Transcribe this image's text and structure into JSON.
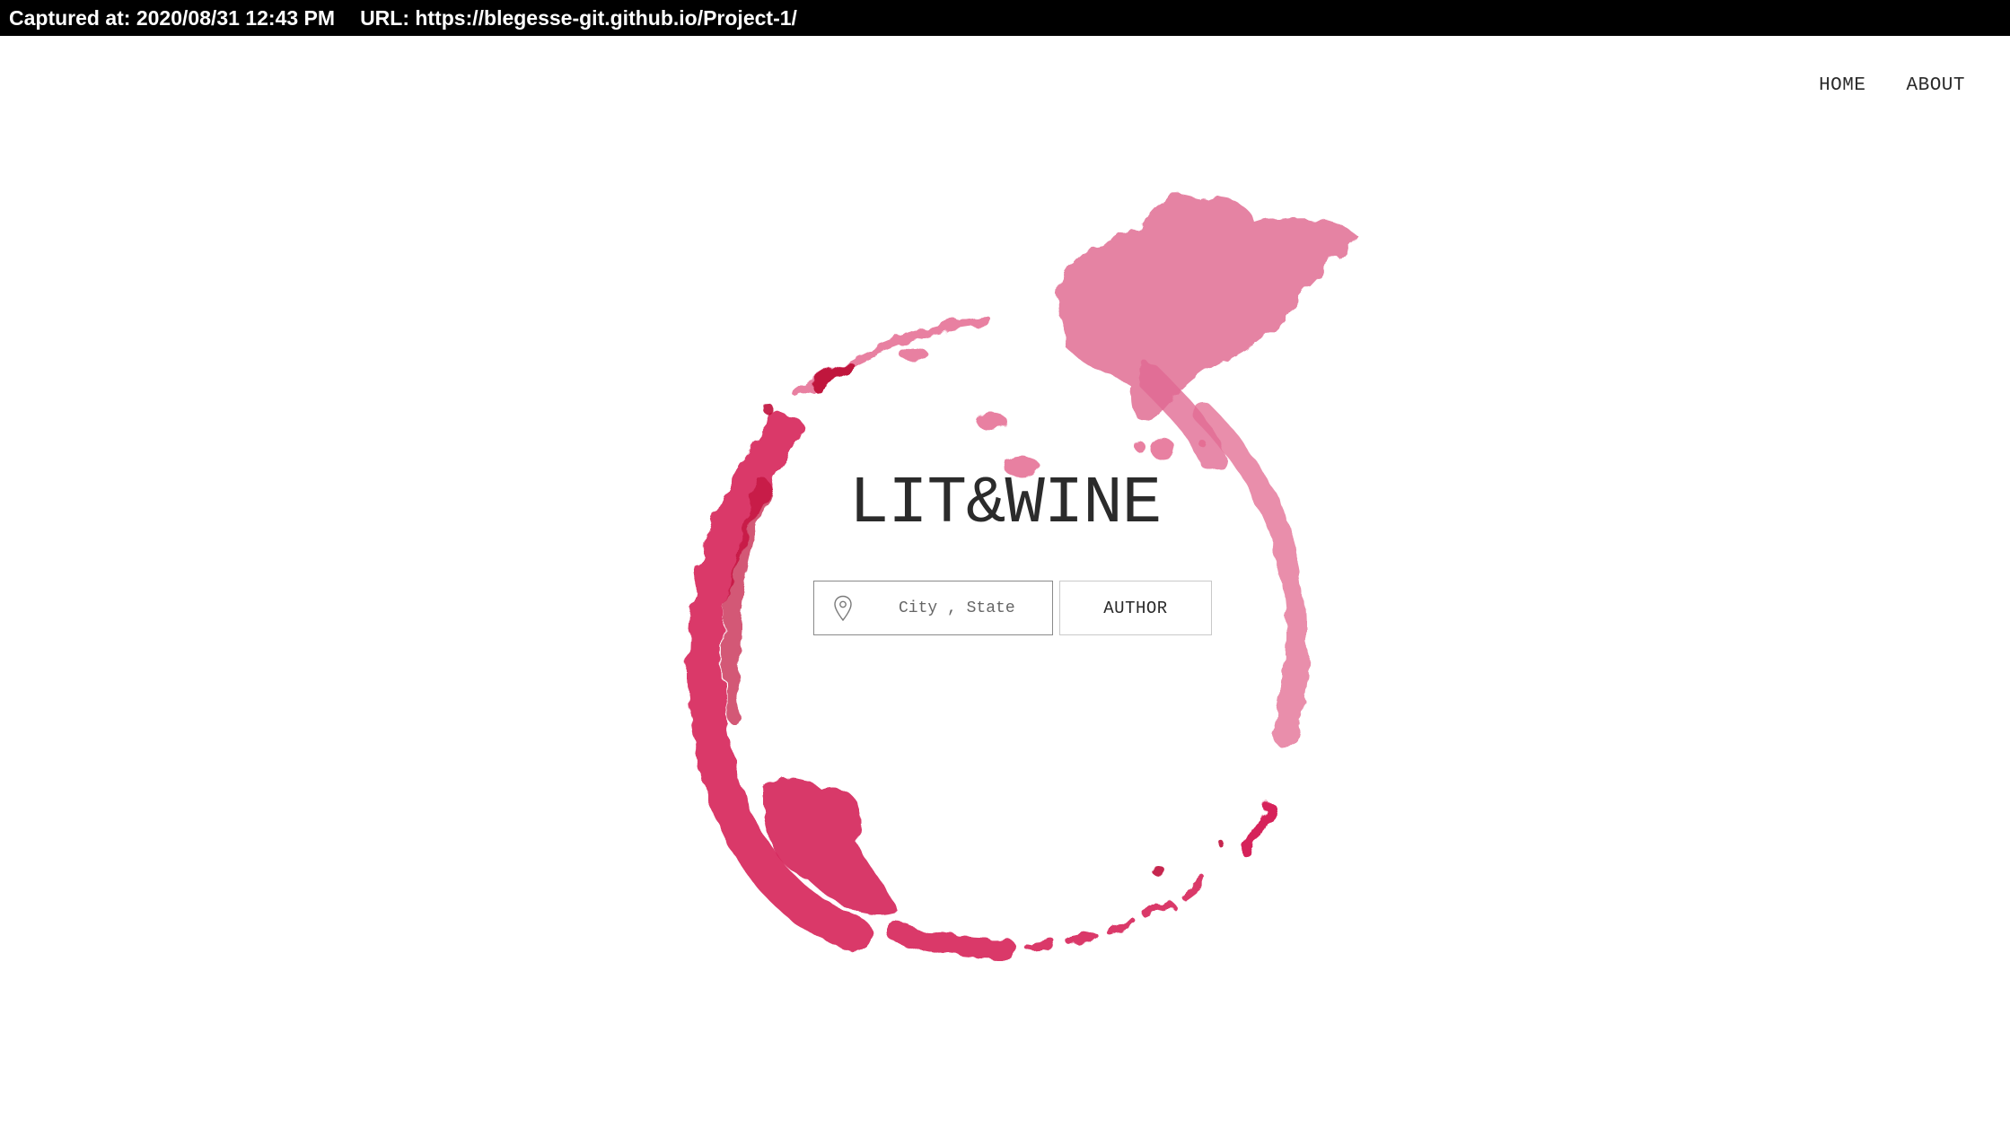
{
  "capture": {
    "captured_at": "Captured at: 2020/08/31 12:43 PM",
    "url": "URL: https://blegesse-git.github.io/Project-1/"
  },
  "nav": {
    "home": "HOME",
    "about": "ABOUT"
  },
  "hero": {
    "title": "LIT&WINE"
  },
  "search": {
    "location_placeholder": "City , State",
    "location_value": "",
    "author_button": "AUTHOR"
  },
  "colors": {
    "wine": "#d6245a",
    "wine_light": "#e57a9c",
    "wine_dark": "#c0123c",
    "text": "#2b2b2b"
  },
  "icons": {
    "location": "map-pin-icon",
    "background": "wine-stain-ring"
  }
}
